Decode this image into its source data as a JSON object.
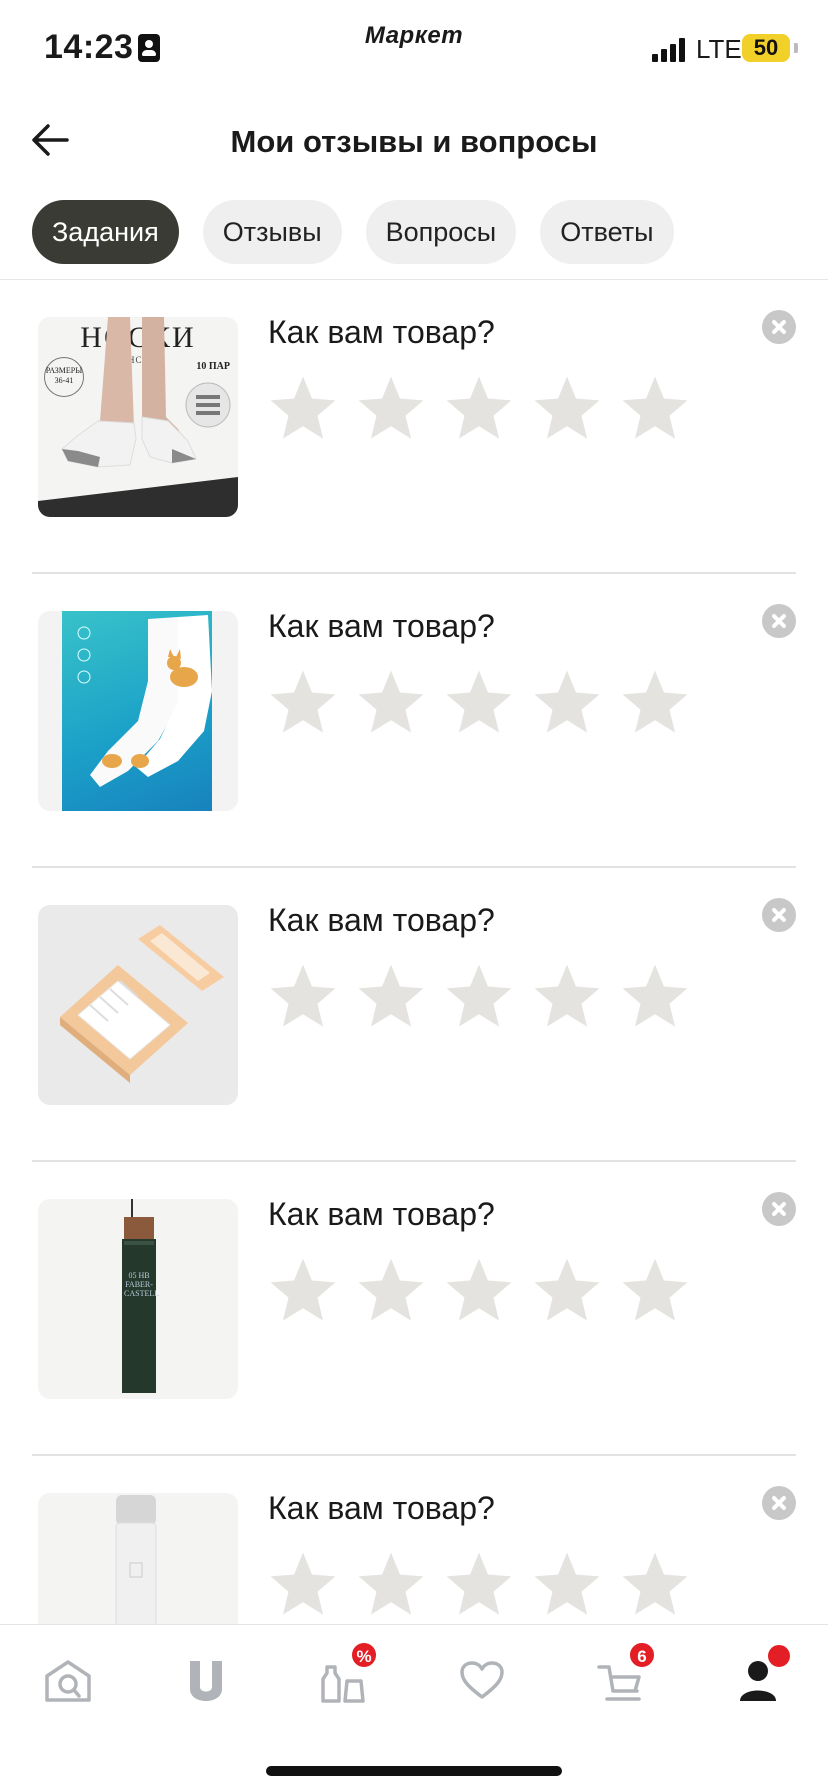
{
  "status_bar": {
    "time": "14:23",
    "app_name": "Маркет",
    "network": "LTE",
    "battery": "50"
  },
  "header": {
    "title": "Мои отзывы и вопросы"
  },
  "tabs": [
    {
      "label": "Задания",
      "active": true
    },
    {
      "label": "Отзывы",
      "active": false
    },
    {
      "label": "Вопросы",
      "active": false
    },
    {
      "label": "Ответы",
      "active": false
    }
  ],
  "review_tasks": [
    {
      "question": "Как вам товар?",
      "rating": 0,
      "max_rating": 5,
      "thumbnail_text": {
        "title": "НОСКИ",
        "subtitle": "ЖЕНСКИЕ",
        "sizes": "РАЗМЕРЫ 36-41",
        "pairs": "10 ПАР"
      }
    },
    {
      "question": "Как вам товар?",
      "rating": 0,
      "max_rating": 5
    },
    {
      "question": "Как вам товар?",
      "rating": 0,
      "max_rating": 5
    },
    {
      "question": "Как вам товар?",
      "rating": 0,
      "max_rating": 5,
      "thumbnail_text": {
        "label": "05 HB FABER-CASTELL"
      }
    },
    {
      "question": "Как вам товар?",
      "rating": 0,
      "max_rating": 5
    }
  ],
  "bottom_nav": {
    "items": [
      {
        "icon": "home-icon"
      },
      {
        "icon": "u-icon"
      },
      {
        "icon": "discount-bottles-icon",
        "badge": "%"
      },
      {
        "icon": "heart-icon"
      },
      {
        "icon": "cart-icon",
        "badge": "6"
      },
      {
        "icon": "profile-icon",
        "active": true
      }
    ]
  },
  "colors": {
    "active_tab": "#3b3b36",
    "inactive_tab": "#efefef",
    "star_empty": "#e5e3df",
    "badge": "#e31e24",
    "battery": "#f2d02a"
  }
}
